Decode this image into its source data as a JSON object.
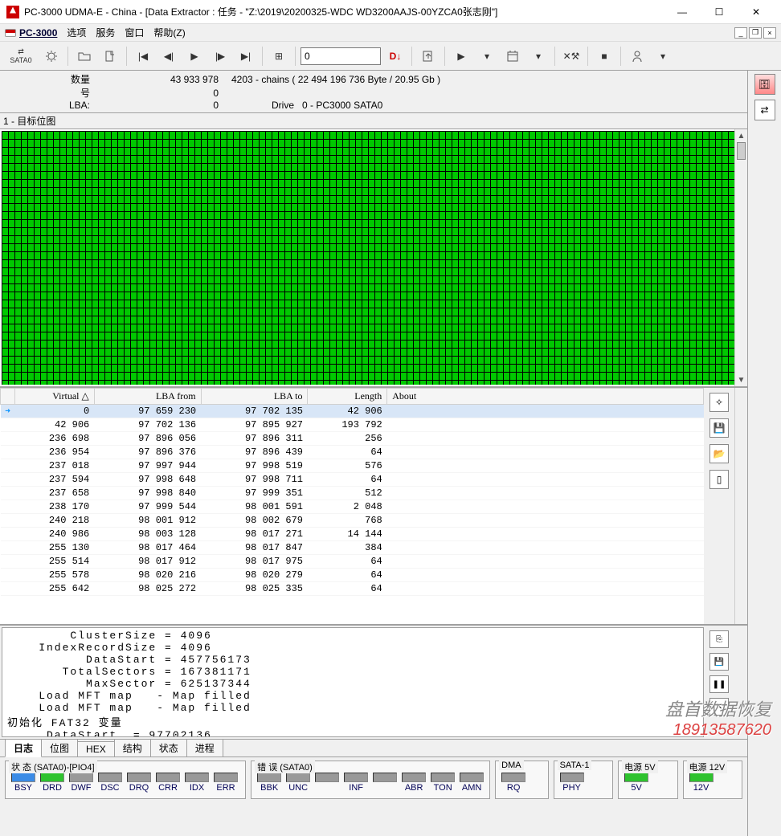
{
  "window": {
    "title": "PC-3000 UDMA-E - China - [Data Extractor : 任务 - \"Z:\\2019\\20200325-WDC WD3200AAJS-00YZCA0张志刚\"]"
  },
  "menu": {
    "pc3000": "PC-3000",
    "items": [
      "选项",
      "服务",
      "窗口",
      "帮助(Z)"
    ]
  },
  "toolbar": {
    "sata_label": "SATA0",
    "number_value": "0",
    "d_label": "D↓"
  },
  "info": {
    "qty_label": "数量",
    "qty_value": "43 933 978",
    "chains": "4203 - chains  ( 22 494 196 736 Byte /  20.95 Gb )",
    "hao_label": "号",
    "hao_value": "0",
    "lba_label": "LBA:",
    "lba_value": "0",
    "drive_label": "Drive",
    "drive_value": "0 - PC3000 SATA0"
  },
  "bitmap_title": "1 - 目标位图",
  "table": {
    "headers": [
      "Virtual  △",
      "LBA from",
      "LBA to",
      "Length",
      "About"
    ],
    "rows": [
      {
        "sel": true,
        "v": "0",
        "from": "97 659 230",
        "to": "97 702 135",
        "len": "42 906",
        "about": ""
      },
      {
        "v": "42 906",
        "from": "97 702 136",
        "to": "97 895 927",
        "len": "193 792",
        "about": ""
      },
      {
        "v": "236 698",
        "from": "97 896 056",
        "to": "97 896 311",
        "len": "256",
        "about": ""
      },
      {
        "v": "236 954",
        "from": "97 896 376",
        "to": "97 896 439",
        "len": "64",
        "about": ""
      },
      {
        "v": "237 018",
        "from": "97 997 944",
        "to": "97 998 519",
        "len": "576",
        "about": ""
      },
      {
        "v": "237 594",
        "from": "97 998 648",
        "to": "97 998 711",
        "len": "64",
        "about": ""
      },
      {
        "v": "237 658",
        "from": "97 998 840",
        "to": "97 999 351",
        "len": "512",
        "about": ""
      },
      {
        "v": "238 170",
        "from": "97 999 544",
        "to": "98 001 591",
        "len": "2 048",
        "about": ""
      },
      {
        "v": "240 218",
        "from": "98 001 912",
        "to": "98 002 679",
        "len": "768",
        "about": ""
      },
      {
        "v": "240 986",
        "from": "98 003 128",
        "to": "98 017 271",
        "len": "14 144",
        "about": ""
      },
      {
        "v": "255 130",
        "from": "98 017 464",
        "to": "98 017 847",
        "len": "384",
        "about": ""
      },
      {
        "v": "255 514",
        "from": "98 017 912",
        "to": "98 017 975",
        "len": "64",
        "about": ""
      },
      {
        "v": "255 578",
        "from": "98 020 216",
        "to": "98 020 279",
        "len": "64",
        "about": ""
      },
      {
        "v": "255 642",
        "from": "98 025 272",
        "to": "98 025 335",
        "len": "64",
        "about": ""
      }
    ]
  },
  "log": "        ClusterSize = 4096\n    IndexRecordSize = 4096\n          DataStart = 457756173\n       TotalSectors = 167381171\n          MaxSector = 625137344\n    Load MFT map   - Map filled\n    Load MFT map   - Map filled\n初始化 FAT32 变量\n ... DataStart  = 97702136",
  "tabs": [
    "日志",
    "位图",
    "HEX",
    "结构",
    "状态",
    "进程"
  ],
  "status_panels": {
    "status": {
      "title": "状 态 (SATA0)-[PIO4]",
      "bits": [
        {
          "lbl": "BSY",
          "on": "blue"
        },
        {
          "lbl": "DRD",
          "on": "green"
        },
        {
          "lbl": "DWF",
          "on": ""
        },
        {
          "lbl": "DSC",
          "on": ""
        },
        {
          "lbl": "DRQ",
          "on": ""
        },
        {
          "lbl": "CRR",
          "on": ""
        },
        {
          "lbl": "IDX",
          "on": ""
        },
        {
          "lbl": "ERR",
          "on": ""
        }
      ]
    },
    "err": {
      "title": "错 误 (SATA0)",
      "bits": [
        {
          "lbl": "BBK",
          "on": ""
        },
        {
          "lbl": "UNC",
          "on": ""
        },
        {
          "lbl": "",
          "on": ""
        },
        {
          "lbl": "INF",
          "on": ""
        },
        {
          "lbl": "",
          "on": ""
        },
        {
          "lbl": "ABR",
          "on": ""
        },
        {
          "lbl": "TON",
          "on": ""
        },
        {
          "lbl": "AMN",
          "on": ""
        }
      ]
    },
    "dma": {
      "title": "DMA",
      "bits": [
        {
          "lbl": "RQ",
          "on": ""
        }
      ]
    },
    "sata1": {
      "title": "SATA-1",
      "bits": [
        {
          "lbl": "PHY",
          "on": ""
        }
      ]
    },
    "pwr5": {
      "title": "电源 5V",
      "bits": [
        {
          "lbl": "5V",
          "on": "green"
        }
      ]
    },
    "pwr12": {
      "title": "电源 12V",
      "bits": [
        {
          "lbl": "12V",
          "on": "green"
        }
      ]
    }
  },
  "watermark": {
    "text": "盘首数据恢复",
    "phone": "18913587620"
  }
}
